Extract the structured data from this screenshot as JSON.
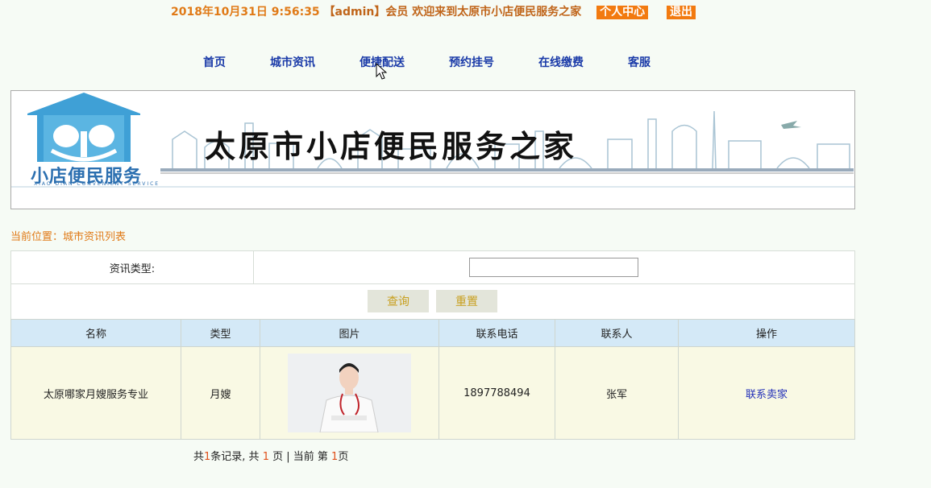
{
  "topbar": {
    "datetime": "2018年10月31日  9:56:35",
    "user": "【admin】会员",
    "welcome": "欢迎来到太原市小店便民服务之家",
    "profile_label": "个人中心",
    "logout_label": "退出"
  },
  "nav": [
    {
      "label": "首页"
    },
    {
      "label": "城市资讯"
    },
    {
      "label": "便捷配送"
    },
    {
      "label": "预约挂号"
    },
    {
      "label": "在线缴费"
    },
    {
      "label": "客服"
    }
  ],
  "banner": {
    "title": "太原市小店便民服务之家",
    "logo_text": "小店便民服务",
    "logo_sub": "XIAO DIAN CONVENIENT SERVICE"
  },
  "breadcrumb": "当前位置：城市资讯列表",
  "search": {
    "type_label": "资讯类型:",
    "type_value": "",
    "query_label": "查询",
    "reset_label": "重置"
  },
  "table": {
    "headers": [
      "名称",
      "类型",
      "图片",
      "联系电话",
      "联系人",
      "操作"
    ],
    "rows": [
      {
        "name": "太原哪家月嫂服务专业",
        "type": "月嫂",
        "phone": "1897788494",
        "contact": "张军",
        "action": "联系卖家"
      }
    ]
  },
  "pager": {
    "prefix": "共",
    "total": "1",
    "mid1": "条记录, 共 ",
    "pages": "1",
    "mid2": " 页 | 当前 第 ",
    "current": "1",
    "suffix": "页"
  },
  "colors": {
    "accent": "#f27a10",
    "nav": "#1a3aa8",
    "header_bg": "#d4e9f7",
    "row_bg": "#f9f9e4"
  }
}
